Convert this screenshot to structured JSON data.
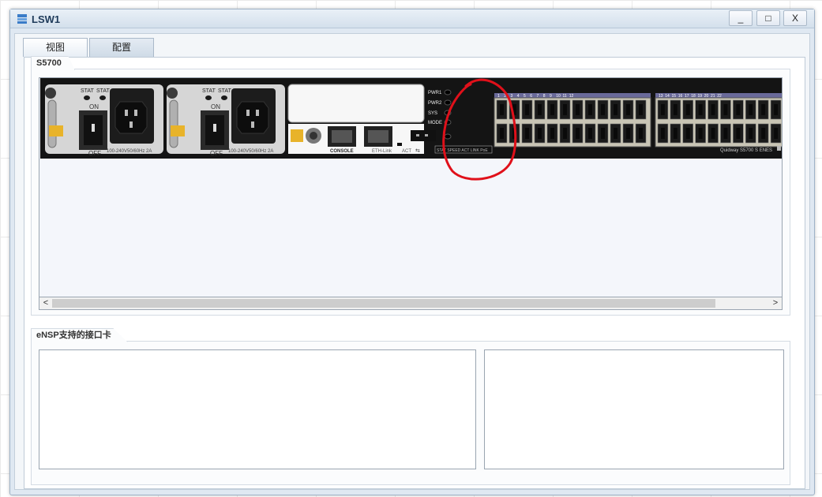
{
  "window": {
    "title": "LSW1",
    "buttons": {
      "minimize": "_",
      "maximize": "□",
      "close": "X"
    }
  },
  "tabs": [
    {
      "label": "视图",
      "active": false
    },
    {
      "label": "配置",
      "active": true
    }
  ],
  "device_panel": {
    "title": "S5700",
    "power_modules": [
      {
        "stat_labels": [
          "STAT",
          "STAT"
        ],
        "switch_on": "ON",
        "switch_off": "OFF",
        "rating": "100-240V50/60Hz 2A"
      },
      {
        "stat_labels": [
          "STAT",
          "STAT"
        ],
        "switch_on": "ON",
        "switch_off": "OFF",
        "rating": "100-240V50/60Hz 2A"
      }
    ],
    "port_labels": {
      "console": "CONSOLE",
      "eth": "ETH-Link",
      "act": "ACT"
    },
    "leds": [
      "PWR1",
      "PWR2",
      "SYS",
      "MODE"
    ],
    "mode_row": "STAT SPEED ACT LINK PoE",
    "port_numbers_a": [
      "1",
      "2",
      "3",
      "4",
      "5",
      "6",
      "7",
      "8",
      "9",
      "10",
      "11",
      "12"
    ],
    "port_numbers_b": [
      "13",
      "14",
      "15",
      "16",
      "17",
      "18",
      "19",
      "20",
      "21",
      "22"
    ],
    "model_label": "Quidway S5700 S ENES",
    "scroll_left": "<",
    "scroll_right": ">"
  },
  "interface_panel": {
    "title": "eNSP支持的接口卡"
  },
  "colors": {
    "annotation": "#e0101a",
    "chassis": "#141414",
    "window_bg": "#dfe8f2"
  }
}
